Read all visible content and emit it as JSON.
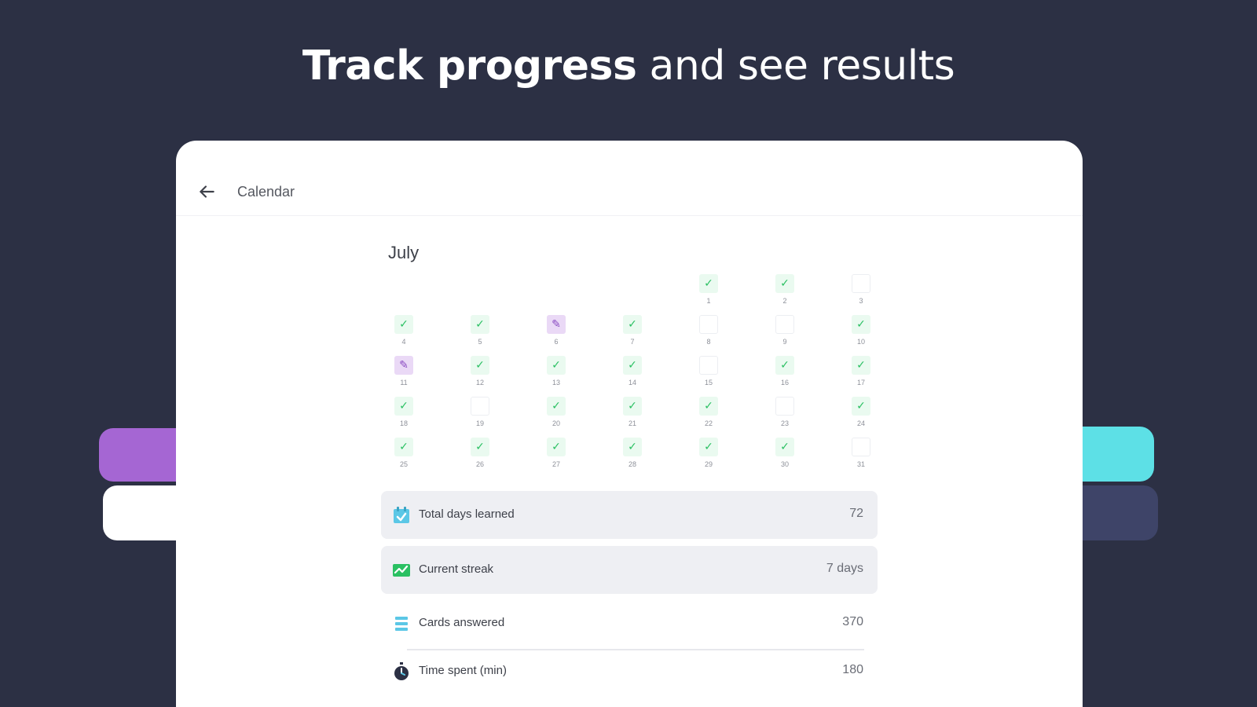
{
  "headline": {
    "bold": "Track progress",
    "rest": "and see results"
  },
  "colors": {
    "background": "#2c3044",
    "purple_accent": "#a566d3",
    "cyan_accent": "#5de0e6",
    "navy_accent": "#3e4468",
    "check_green": "#2ac062",
    "edit_purple": "#8a4bc2"
  },
  "topbar": {
    "back_icon": "arrow-left-icon",
    "title": "Calendar"
  },
  "calendar": {
    "month": "July",
    "weeks": [
      [
        null,
        null,
        null,
        null,
        {
          "d": "1",
          "s": "done"
        },
        {
          "d": "2",
          "s": "done"
        },
        {
          "d": "3",
          "s": "empty"
        }
      ],
      [
        {
          "d": "4",
          "s": "done"
        },
        {
          "d": "5",
          "s": "done"
        },
        {
          "d": "6",
          "s": "edit"
        },
        {
          "d": "7",
          "s": "done"
        },
        {
          "d": "8",
          "s": "empty"
        },
        {
          "d": "9",
          "s": "empty"
        },
        {
          "d": "10",
          "s": "done"
        }
      ],
      [
        {
          "d": "11",
          "s": "edit"
        },
        {
          "d": "12",
          "s": "done"
        },
        {
          "d": "13",
          "s": "done"
        },
        {
          "d": "14",
          "s": "done"
        },
        {
          "d": "15",
          "s": "empty"
        },
        {
          "d": "16",
          "s": "done"
        },
        {
          "d": "17",
          "s": "done"
        }
      ],
      [
        {
          "d": "18",
          "s": "done"
        },
        {
          "d": "19",
          "s": "empty"
        },
        {
          "d": "20",
          "s": "done"
        },
        {
          "d": "21",
          "s": "done"
        },
        {
          "d": "22",
          "s": "done"
        },
        {
          "d": "23",
          "s": "empty"
        },
        {
          "d": "24",
          "s": "done"
        }
      ],
      [
        {
          "d": "25",
          "s": "done"
        },
        {
          "d": "26",
          "s": "done"
        },
        {
          "d": "27",
          "s": "done"
        },
        {
          "d": "28",
          "s": "done"
        },
        {
          "d": "29",
          "s": "done"
        },
        {
          "d": "30",
          "s": "done"
        },
        {
          "d": "31",
          "s": "empty"
        }
      ]
    ]
  },
  "stats": [
    {
      "icon": "calendar-check-icon",
      "label": "Total days learned",
      "value": "72"
    },
    {
      "icon": "streak-chart-icon",
      "label": "Current streak",
      "value": "7 days"
    },
    {
      "icon": "cards-list-icon",
      "label": "Cards answered",
      "value": "370"
    },
    {
      "icon": "stopwatch-icon",
      "label": "Time spent (min)",
      "value": "180"
    }
  ]
}
